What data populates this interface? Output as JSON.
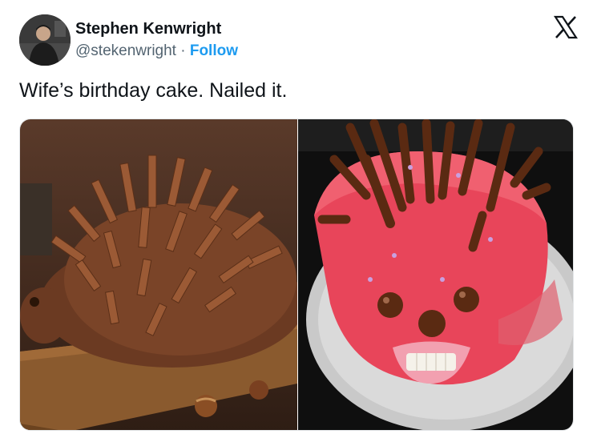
{
  "author": {
    "name": "Stephen Kenwright",
    "handle": "@stekenwright",
    "separator": "·",
    "follow_label": "Follow"
  },
  "brand": {
    "icon": "x-logo-icon"
  },
  "tweet": {
    "text": "Wife’s birthday cake. Nailed it."
  },
  "media": {
    "left_image": "chocolate-hedgehog-cake-photo",
    "right_image": "pink-hedgehog-cake-photo"
  },
  "colors": {
    "link": "#1d9bf0",
    "text": "#0f1419",
    "secondary": "#536471"
  }
}
